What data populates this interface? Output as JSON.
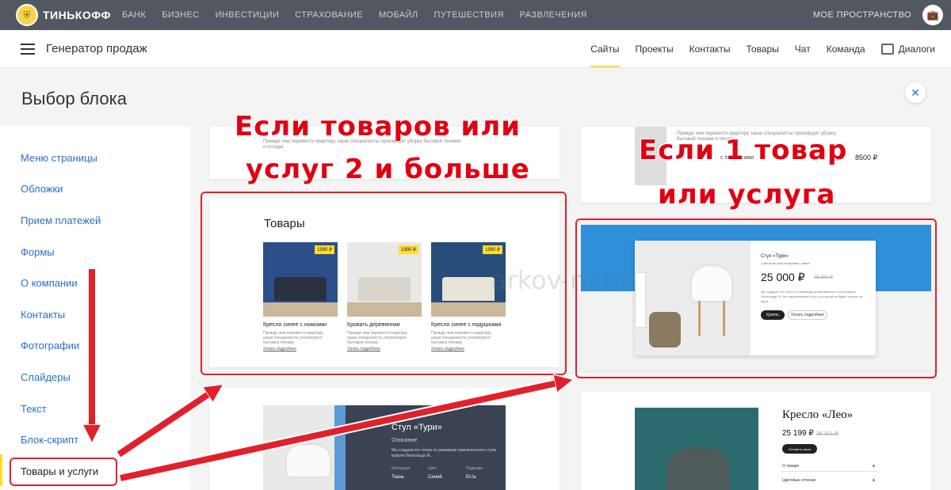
{
  "topbar": {
    "brand": "ТИНЬКОФФ",
    "nav": [
      "БАНК",
      "БИЗНЕС",
      "ИНВЕСТИЦИИ",
      "СТРАХОВАНИЕ",
      "МОБАЙЛ",
      "ПУТЕШЕСТВИЯ",
      "РАЗВЛЕЧЕНИЯ"
    ],
    "my_space": "МОЕ ПРОСТРАНСТВО"
  },
  "header": {
    "title": "Генератор продаж",
    "nav": [
      "Сайты",
      "Проекты",
      "Контакты",
      "Товары",
      "Чат",
      "Команда"
    ],
    "dialogs": "Диалоги"
  },
  "panel": {
    "title": "Выбор блока",
    "close": "✕"
  },
  "sidebar": {
    "items": [
      "Меню страницы",
      "Обложки",
      "Прием платежей",
      "Формы",
      "О компании",
      "Контакты",
      "Фотографии",
      "Слайдеры",
      "Текст",
      "Блок-скрипт",
      "Товары и услуги"
    ]
  },
  "blocks": {
    "top_left_text": "Прежде чем перевести квартиру, наши специалисты производят уборку бытовой техники и посуды",
    "top_right_text": "Прежде чем перевести квартиру, наши специалисты производят уборку бытовой техники и посуды",
    "top_right_caption": "с подушками",
    "top_right_price": "8500 ₽",
    "products_title": "Товары",
    "products": [
      {
        "name": "Кресло синее с ножками",
        "price": "1990 ₽",
        "desc": "Прежде чем перевести квартиру, наши специалисты утилизируют бытовую технику",
        "link": "Узнать подробнее"
      },
      {
        "name": "Кровать деревянная",
        "price": "1990 ₽",
        "desc": "Прежде чем перевести квартиру, наши специалисты утилизируют бытовую технику",
        "link": "Узнать подробнее"
      },
      {
        "name": "Кресло синее с подушками",
        "price": "1990 ₽",
        "desc": "Прежде чем перевести квартиру, наши специалисты утилизируют бытовую технику",
        "link": "Узнать подробнее"
      }
    ],
    "stool": {
      "title": "Стул «Тури»",
      "subtitle": "Описание",
      "desc": "Мы создали его точно по размерам оригинального стула короля Леопольда III.",
      "specs": [
        [
          "Материал",
          "Цвет",
          "Подошва"
        ],
        [
          "Ткань",
          "Синий",
          "Есть"
        ]
      ]
    },
    "turi": {
      "title": "Стул «Тури»",
      "subtitle": "1-местное кресло-кровать, синее",
      "price": "25 000 ₽",
      "old_price": "45 950 ₽",
      "desc": "Мы создали его точно по размерам оригинального стула короля Леопольда III. Это единственный стул, в котором не будет скрыта ни одна.",
      "buy": "Купить",
      "more": "Узнать подробнее"
    },
    "leo": {
      "title": "Кресло «Лео»",
      "price": "25 199 ₽",
      "old_price": "35 301 ₽",
      "buy": "Оставить заказ",
      "rows": [
        "О товаре",
        "Цветовые оттенки"
      ]
    }
  },
  "annotations": {
    "multi_line1": "Если товаров или",
    "multi_line2": "услуг 2 и больше",
    "single_line1": "Если 1 товар",
    "single_line2": "или услуга"
  },
  "watermark": "arkov-m.ru",
  "colors": {
    "topbar": "#535760",
    "accent": "#ffdd2d",
    "link": "#2a6fc7",
    "annotation": "#e10012"
  }
}
